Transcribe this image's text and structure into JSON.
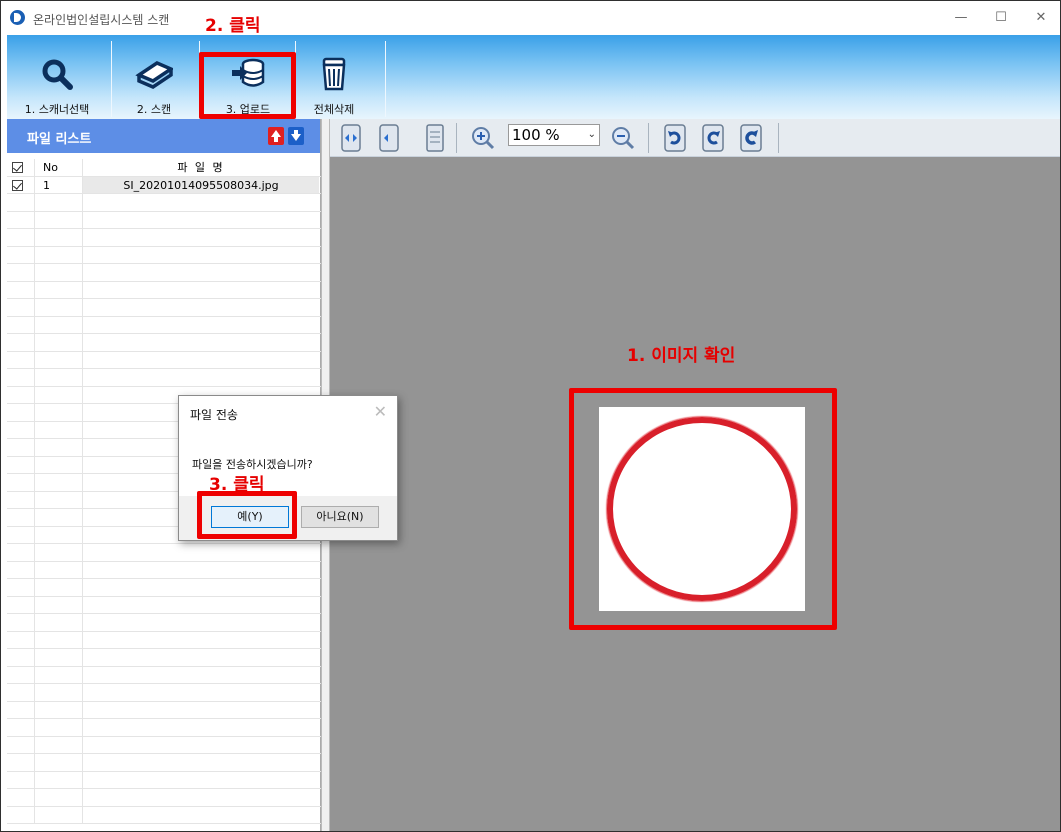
{
  "window": {
    "title": "온라인법인설립시스템 스캔",
    "minimize": "—",
    "maximize": "☐",
    "close": "✕"
  },
  "toolbar": {
    "items": [
      {
        "label": "1. 스캐너선택",
        "icon": "search-icon"
      },
      {
        "label": "2. 스캔",
        "icon": "scanner-icon"
      },
      {
        "label": "3. 업로드",
        "icon": "upload-database-icon"
      },
      {
        "label": "전체삭제",
        "icon": "trash-icon"
      }
    ]
  },
  "file_list": {
    "title": "파일 리스트",
    "columns": {
      "no": "No",
      "name": "파 일 명"
    },
    "rows": [
      {
        "no": "1",
        "name": "SI_20201014095508034.jpg",
        "checked": true
      }
    ]
  },
  "viewer": {
    "zoom": "100 %",
    "dropdown_glyph": "⌄"
  },
  "dialog": {
    "title": "파일 전송",
    "close": "✕",
    "message": "파일을 전송하시겠습니까?",
    "yes": "예(Y)",
    "no": "아니요(N)"
  },
  "annotations": {
    "step1": "1. 이미지 확인",
    "step2": "2. 클릭",
    "step3": "3. 클릭"
  },
  "colors": {
    "annotation_red": "#ee0000",
    "panel_header": "#5d8ee6",
    "stamp_red": "#d81f2a"
  }
}
